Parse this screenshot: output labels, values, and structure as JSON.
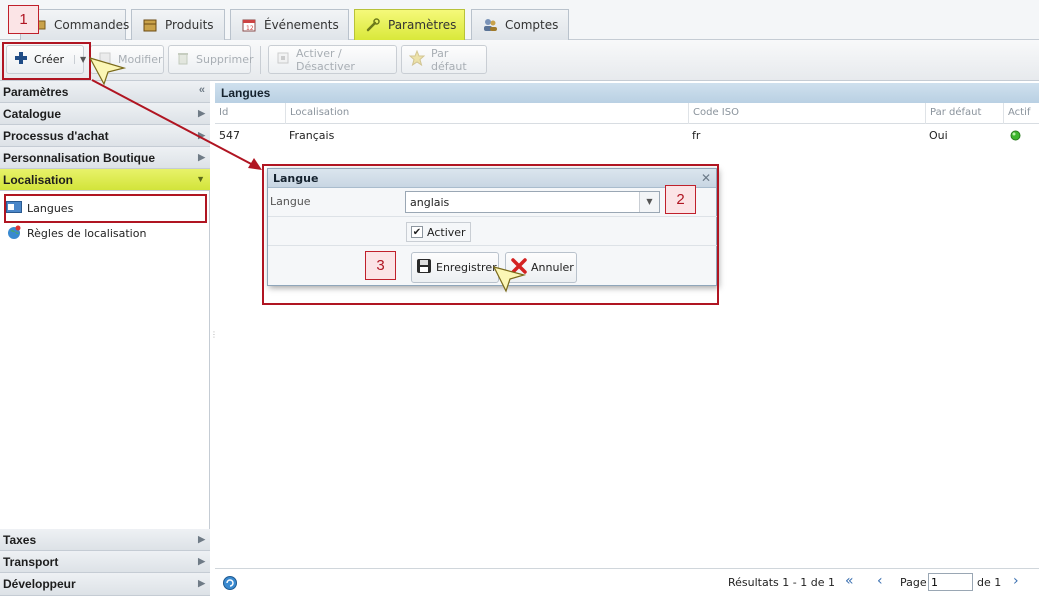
{
  "tabs": [
    {
      "label": "Commandes",
      "icon": "cart-icon"
    },
    {
      "label": "Produits",
      "icon": "box-icon"
    },
    {
      "label": "Événements",
      "icon": "calendar-icon"
    },
    {
      "label": "Paramètres",
      "icon": "wrench-icon",
      "active": true
    },
    {
      "label": "Comptes",
      "icon": "users-icon"
    }
  ],
  "toolbar": {
    "create": "Créer",
    "edit": "Modifier",
    "delete": "Supprimer",
    "toggle": "Activer / Désactiver",
    "default": "Par défaut"
  },
  "sidebar": {
    "header": "Paramètres",
    "sections": [
      "Catalogue",
      "Processus d'achat",
      "Personnalisation Boutique",
      "Localisation"
    ],
    "tree": [
      "Langues",
      "Règles de localisation"
    ],
    "bottom": [
      "Taxes",
      "Transport",
      "Développeur"
    ]
  },
  "grid": {
    "title": "Langues",
    "columns": [
      "Id",
      "Localisation",
      "Code ISO",
      "Par défaut",
      "Actif"
    ],
    "row": {
      "id": "547",
      "localisation": "Français",
      "iso": "fr",
      "default": "Oui",
      "active": true
    }
  },
  "pager": {
    "results": "Résultats 1 - 1 de 1",
    "page_label": "Page",
    "page_value": "1",
    "of": "de 1"
  },
  "dialog": {
    "title": "Langue",
    "field_label": "Langue",
    "field_value": "anglais",
    "checkbox_label": "Activer",
    "checked": true,
    "save": "Enregistrer",
    "cancel": "Annuler"
  },
  "callouts": [
    "1",
    "2",
    "3"
  ],
  "colors": {
    "accent_yellow": "#d9e83a",
    "red_annotation": "#b01522",
    "header_blue": "#c8d6e3"
  }
}
